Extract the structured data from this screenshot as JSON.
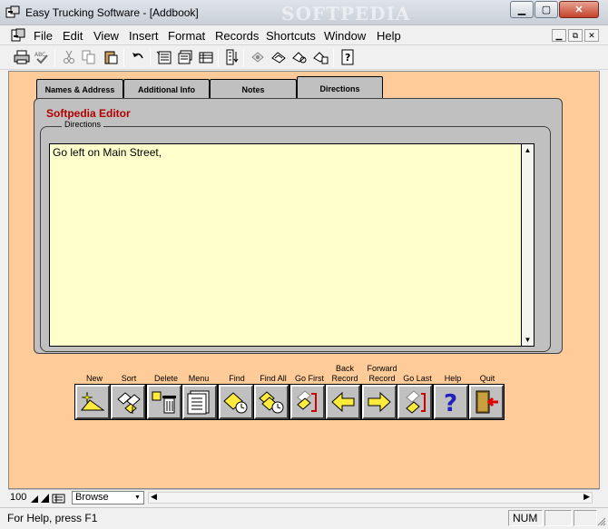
{
  "window": {
    "title": "Easy Trucking Software - [Addbook]",
    "watermark": "SOFTPEDIA",
    "minimize": "▁",
    "maximize": "▢",
    "close": "✕"
  },
  "menu": [
    "File",
    "Edit",
    "View",
    "Insert",
    "Format",
    "Records",
    "Shortcuts",
    "Window",
    "Help"
  ],
  "mdi_controls": [
    "▁",
    "⧉",
    "✕"
  ],
  "toolbar_icons": [
    "print-icon",
    "spellcheck-icon",
    "cut-icon",
    "copy-icon",
    "paste-icon",
    "undo-icon",
    "form-view-icon",
    "list-view-icon",
    "table-view-icon",
    "sort-records-icon",
    "layout-icon",
    "browse-mode-icon",
    "find-mode-icon",
    "preview-mode-icon",
    "context-help-icon"
  ],
  "tabs": {
    "names_address": "Names & Address",
    "additional_info": "Additional Info",
    "notes": "Notes",
    "directions": "Directions"
  },
  "editor": {
    "title": "Softpedia Editor",
    "group_label": "Directions",
    "text": "Go left on Main Street,"
  },
  "buttons": {
    "new": [
      "New"
    ],
    "sort": [
      "Sort"
    ],
    "delete": [
      "Delete"
    ],
    "menu": [
      "Menu"
    ],
    "find": [
      "Find"
    ],
    "find_all": [
      "Find All"
    ],
    "go_first": [
      "Go First"
    ],
    "back_record": [
      "Back",
      "Record"
    ],
    "forward_record": [
      "Forward",
      "Record"
    ],
    "go_last": [
      "Go Last"
    ],
    "help": [
      "Help"
    ],
    "quit": [
      "Quit"
    ]
  },
  "navbar": {
    "zoom": "100",
    "mode": "Browse"
  },
  "status": {
    "help_text": "For Help, press F1",
    "num": "NUM"
  },
  "colors": {
    "client_background": "#ffcc99",
    "panel": "#c0c0c0",
    "text_area": "#ffffcc",
    "editor_title": "#b00000"
  }
}
